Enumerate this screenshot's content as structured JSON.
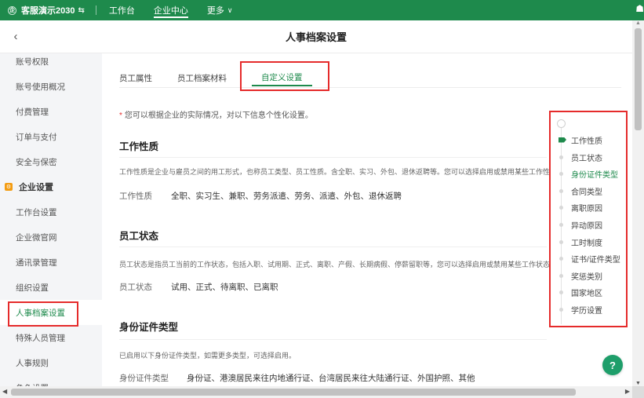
{
  "topbar": {
    "brand": "客服演示2030",
    "brand_switch_icon": "switch-icon",
    "nav": [
      {
        "label": "工作台",
        "active": false
      },
      {
        "label": "企业中心",
        "active": true
      }
    ],
    "more_label": "更多",
    "more_arrow": "∨",
    "right_icon": "☗"
  },
  "titlebar": {
    "back_icon": "‹",
    "title": "人事档案设置"
  },
  "sidebar": {
    "items_top": [
      "账号权限",
      "账号使用概况",
      "付费管理",
      "订单与支付",
      "安全与保密"
    ],
    "group_label": "企业设置",
    "group_icon": "⚙",
    "items_group": [
      "工作台设置",
      "企业微官网",
      "通讯录管理",
      "组织设置",
      "人事档案设置",
      "特殊人员管理",
      "人事规则",
      "角色设置"
    ],
    "active_item": "人事档案设置"
  },
  "tabs": [
    {
      "label": "员工属性"
    },
    {
      "label": "员工档案材料"
    },
    {
      "label": "自定义设置",
      "active": true
    }
  ],
  "note": {
    "star": "*",
    "text": "您可以根据企业的实际情况，对以下信息个性化设置。"
  },
  "sections": {
    "work_nature": {
      "title": "工作性质",
      "desc": "工作性质是企业与雇员之间的用工形式，也称员工类型、员工性质。含全职、实习、外包、退休返聘等。您可以选择启用或禁用某些工作性质。",
      "label": "工作性质",
      "value": "全职、实习生、兼职、劳务派遣、劳务、派遣、外包、退休返聘"
    },
    "employee_status": {
      "title": "员工状态",
      "desc": "员工状态是指员工当前的工作状态，包括入职、试用期、正式、离职、产假、长期病假、停薪留职等，您可以选择启用或禁用某些工作状态。",
      "label": "员工状态",
      "value": "试用、正式、待离职、已离职"
    },
    "id_type": {
      "title": "身份证件类型",
      "desc": "已启用以下身份证件类型，如需更多类型，可选择启用。",
      "label": "身份证件类型",
      "value": "身份证、港澳居民来往内地通行证、台湾居民来往大陆通行证、外国护照、其他"
    }
  },
  "anchor_nav": {
    "items": [
      "工作性质",
      "员工状态",
      "身份证件类型",
      "合同类型",
      "离职原因",
      "异动原因",
      "工时制度",
      "证书/证件类型",
      "奖惩类别",
      "国家地区",
      "学历设置"
    ],
    "current": "工作性质",
    "highlighted": "身份证件类型"
  },
  "help": {
    "icon": "?"
  },
  "scroll": {
    "up": "▲",
    "down": "▼",
    "left": "◀",
    "right": "▶"
  },
  "colors": {
    "brand": "#1e8a4c",
    "highlight_box": "#e52b2b",
    "accent_warning": "#f39c12"
  }
}
